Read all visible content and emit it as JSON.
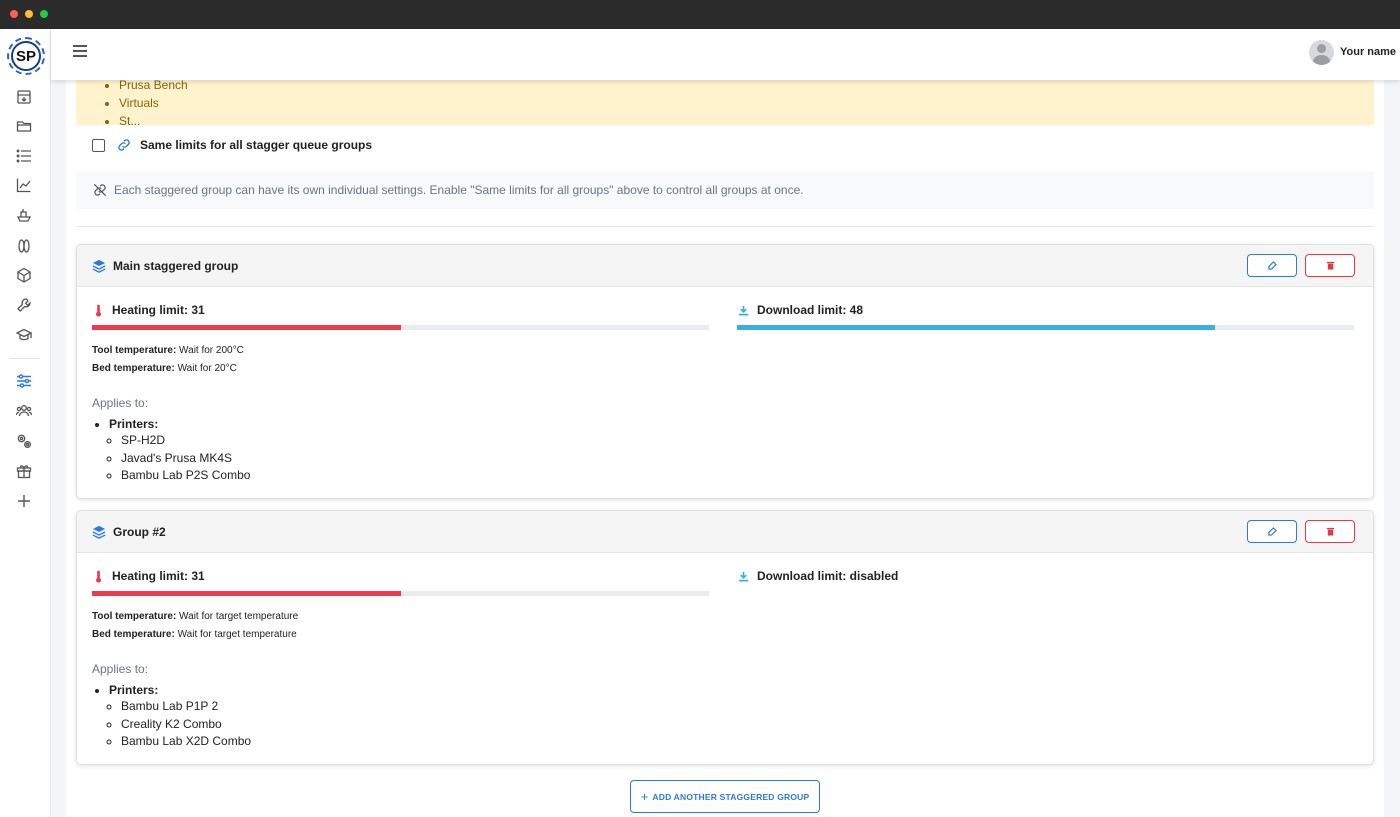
{
  "header": {
    "user_name": "Your name"
  },
  "logo_text": "SP",
  "sidebar": {
    "icons": [
      "printer-icon",
      "folder-icon",
      "list-icon",
      "chart-icon",
      "boat-icon",
      "filament-icon",
      "cube-icon",
      "wrench-icon",
      "graduation-cap-icon",
      "sliders-icon",
      "users-icon",
      "gears-icon",
      "gift-icon",
      "plus-icon"
    ]
  },
  "alert": {
    "items": [
      "Prusa Bench",
      "Virtuals",
      "St..."
    ]
  },
  "same_limits": {
    "label": "Same limits for all stagger queue groups",
    "checked": false
  },
  "info": {
    "text": "Each staggered group can have its own individual settings. Enable \"Same limits for all groups\" above to control all groups at once."
  },
  "groups": [
    {
      "title": "Main staggered group",
      "heating_label": "Heating limit: 31",
      "heating_fraction": 0.5,
      "download_label": "Download limit: 48",
      "download_fraction": 0.775,
      "tool_temp_label": "Tool temperature:",
      "tool_temp_value": " Wait for 200°C",
      "bed_temp_label": "Bed temperature:",
      "bed_temp_value": " Wait for 20°C",
      "applies_label": "Applies to:",
      "printers_header": "Printers:",
      "printers": [
        "SP-H2D",
        "Javad's Prusa MK4S",
        "Bambu Lab P2S Combo"
      ]
    },
    {
      "title": "Group #2",
      "heating_label": "Heating limit: 31",
      "heating_fraction": 0.5,
      "download_label": "Download limit: disabled",
      "tool_temp_label": "Tool temperature:",
      "tool_temp_value": " Wait for target temperature",
      "bed_temp_label": "Bed temperature:",
      "bed_temp_value": " Wait for target temperature",
      "applies_label": "Applies to:",
      "printers_header": "Printers:",
      "printers": [
        "Bambu Lab P1P 2",
        "Creality K2 Combo",
        "Bambu Lab X2D Combo"
      ]
    }
  ],
  "add_button": {
    "label": "ADD ANOTHER STAGGERED GROUP"
  },
  "colors": {
    "primary": "#2a7ae2",
    "danger": "#e53946",
    "heating_bar": "#f1394a",
    "download_bar": "#3ab0e2",
    "alert_bg": "#fff3cd"
  }
}
